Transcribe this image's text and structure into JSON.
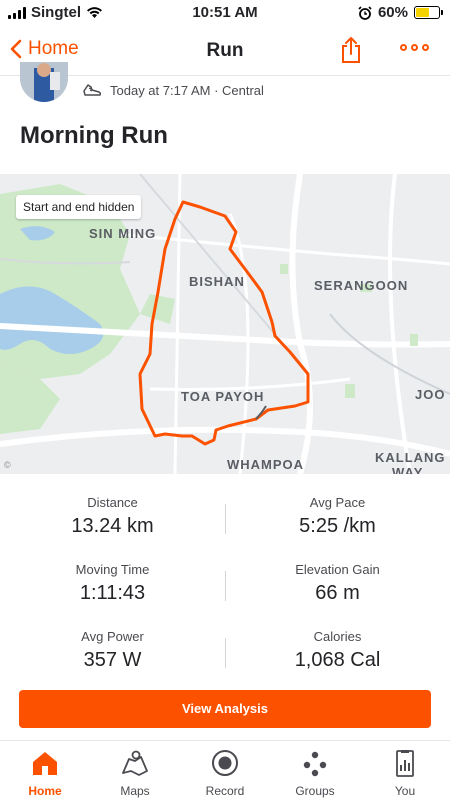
{
  "status_bar": {
    "carrier": "Singtel",
    "time": "10:51 AM",
    "battery": "60%",
    "battery_level": 0.6
  },
  "nav": {
    "back_label": "Home",
    "title": "Run"
  },
  "activity": {
    "meta": "Today at 7:17 AM · Central",
    "title": "Morning Run"
  },
  "map": {
    "privacy_chip": "Start and end hidden",
    "labels": [
      "SIN MING",
      "BISHAN",
      "SERANGOON",
      "TOA PAYOH",
      "JOO",
      "WHAMPOA",
      "KALLANG",
      "WAY"
    ],
    "route_color": "#fc5200"
  },
  "stats": [
    {
      "label": "Distance",
      "value": "13.24 km"
    },
    {
      "label": "Avg Pace",
      "value": "5:25 /km"
    },
    {
      "label": "Moving Time",
      "value": "1:11:43"
    },
    {
      "label": "Elevation Gain",
      "value": "66 m"
    },
    {
      "label": "Avg Power",
      "value": "357 W"
    },
    {
      "label": "Calories",
      "value": "1,068 Cal"
    }
  ],
  "cta": {
    "label": "View Analysis"
  },
  "tabs": [
    {
      "label": "Home",
      "icon": "home-icon",
      "active": true
    },
    {
      "label": "Maps",
      "icon": "maps-icon",
      "active": false
    },
    {
      "label": "Record",
      "icon": "record-icon",
      "active": false
    },
    {
      "label": "Groups",
      "icon": "groups-icon",
      "active": false
    },
    {
      "label": "You",
      "icon": "you-icon",
      "active": false
    }
  ],
  "colors": {
    "accent": "#fc5200",
    "text": "#242428",
    "muted": "#4a4a50"
  }
}
